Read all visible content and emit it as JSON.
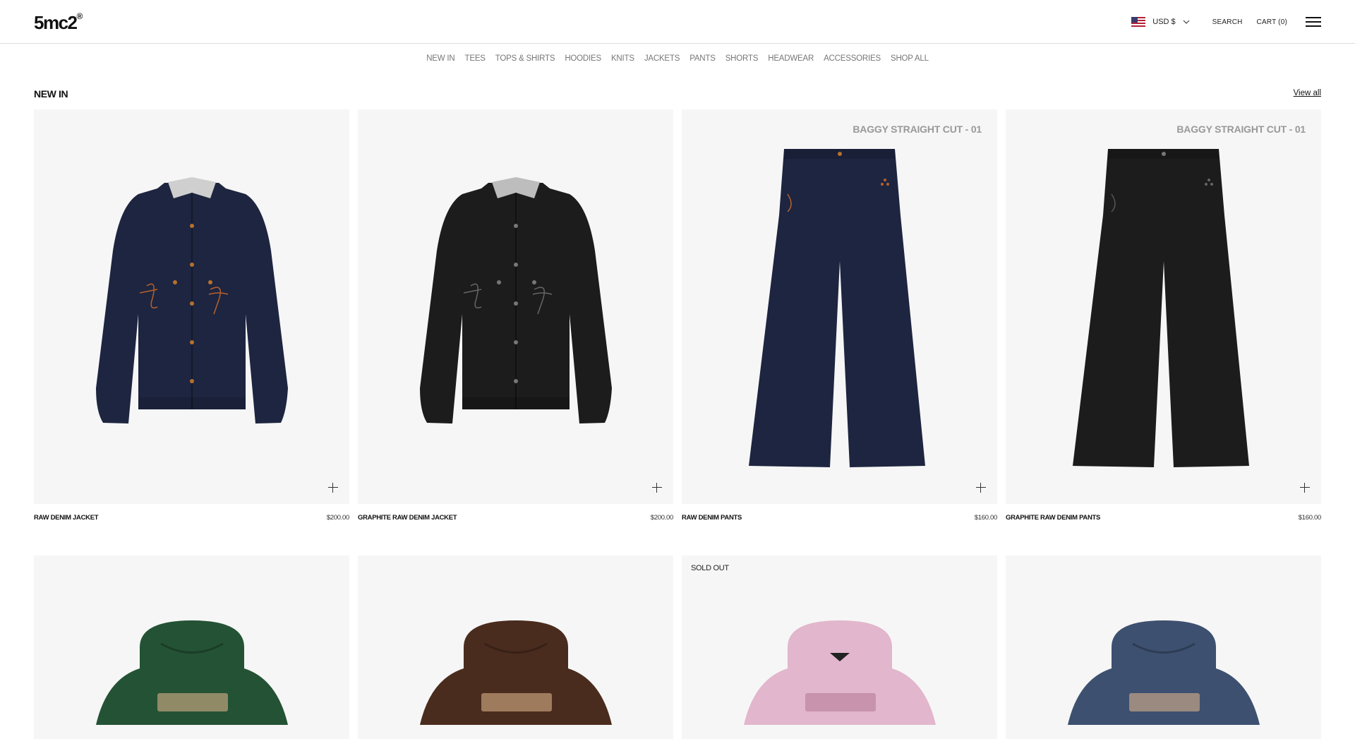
{
  "header": {
    "logo": "5mc2",
    "logo_mark": "®",
    "currency": "USD $",
    "search": "SEARCH",
    "cart": "CART (0)"
  },
  "nav": [
    "NEW IN",
    "TEES",
    "TOPS & SHIRTS",
    "HOODIES",
    "KNITS",
    "JACKETS",
    "PANTS",
    "SHORTS",
    "HEADWEAR",
    "ACCESSORIES",
    "SHOP ALL"
  ],
  "section": {
    "title": "NEW IN",
    "view_all": "View all"
  },
  "products": [
    {
      "name": "RAW DENIM JACKET",
      "price": "$200.00",
      "color": "#1d2540",
      "type": "jacket"
    },
    {
      "name": "GRAPHITE RAW DENIM JACKET",
      "price": "$200.00",
      "color": "#1c1c1c",
      "type": "jacket"
    },
    {
      "name": "RAW DENIM PANTS",
      "price": "$160.00",
      "color": "#1d2540",
      "type": "pants",
      "badge": "BAGGY STRAIGHT CUT - 01"
    },
    {
      "name": "GRAPHITE RAW DENIM PANTS",
      "price": "$160.00",
      "color": "#1c1c1c",
      "type": "pants",
      "badge": "BAGGY STRAIGHT CUT - 01"
    }
  ],
  "products_row2": [
    {
      "color": "#245235",
      "type": "hoodie"
    },
    {
      "color": "#4a2c1e",
      "type": "hoodie"
    },
    {
      "color": "#e2b6cc",
      "type": "hoodie",
      "status": "SOLD OUT"
    },
    {
      "color": "#3d5070",
      "type": "hoodie"
    }
  ]
}
